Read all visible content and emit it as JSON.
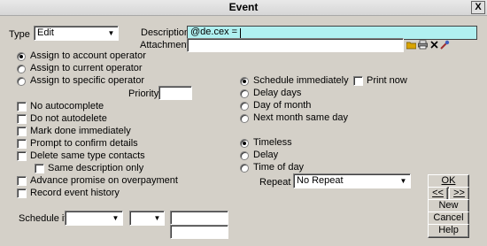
{
  "window": {
    "title": "Event",
    "close_glyph": "X"
  },
  "type": {
    "label": "Type",
    "value": "Edit"
  },
  "description": {
    "label": "Description",
    "value": "@de.cex ="
  },
  "attachment": {
    "label": "Attachment",
    "value": ""
  },
  "assign": {
    "options": [
      {
        "label": "Assign to account operator",
        "selected": true
      },
      {
        "label": "Assign to current operator",
        "selected": false
      },
      {
        "label": "Assign to specific operator",
        "selected": false
      }
    ],
    "priority_label": "Priority",
    "priority_value": ""
  },
  "checks": [
    {
      "label": "No autocomplete",
      "checked": false
    },
    {
      "label": "Do not autodelete",
      "checked": false
    },
    {
      "label": "Mark done immediately",
      "checked": false
    },
    {
      "label": "Prompt to confirm details",
      "checked": false
    },
    {
      "label": "Delete same type contacts",
      "checked": false
    },
    {
      "label": "Same description only",
      "checked": false
    },
    {
      "label": "Advance promise on overpayment",
      "checked": false
    },
    {
      "label": "Record event history",
      "checked": false
    }
  ],
  "schedule": {
    "options": [
      {
        "label": "Schedule immediately",
        "selected": true
      },
      {
        "label": "Delay days",
        "selected": false
      },
      {
        "label": "Day of month",
        "selected": false
      },
      {
        "label": "Next month same day",
        "selected": false
      }
    ],
    "print_now": {
      "label": "Print now",
      "checked": false
    }
  },
  "timing": {
    "options": [
      {
        "label": "Timeless",
        "selected": true
      },
      {
        "label": "Delay",
        "selected": false
      },
      {
        "label": "Time of day",
        "selected": false
      }
    ],
    "repeat_label": "Repeat",
    "repeat_value": "No Repeat"
  },
  "schedule_if": {
    "label": "Schedule if",
    "field1": "",
    "field2": "",
    "text1": "",
    "text2": ""
  },
  "buttons": {
    "ok": "OK",
    "prev": "<<",
    "next": ">>",
    "new": "New",
    "cancel": "Cancel",
    "help": "Help"
  },
  "icons": [
    "folder-icon",
    "printer-icon",
    "delete-icon",
    "tools-icon"
  ]
}
